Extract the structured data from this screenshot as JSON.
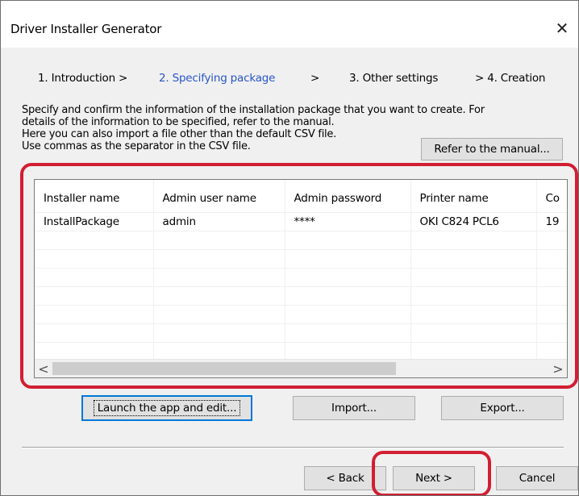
{
  "window": {
    "title": "Driver Installer Generator",
    "close_glyph": "✕"
  },
  "steps": [
    {
      "label": "1. Introduction >"
    },
    {
      "label": "2. Specifying package"
    },
    {
      "label": ">"
    },
    {
      "label": "3. Other settings"
    },
    {
      "label": "> 4. Creation"
    }
  ],
  "description": {
    "line1": "Specify and confirm the information of the installation package that you want to create. For",
    "line2": "details of the information to be specified, refer to the manual.",
    "line3": "Here you can also import a file other than the default CSV file.",
    "line4": "Use commas as the separator in the CSV file."
  },
  "buttons": {
    "manual": "Refer to the manual...",
    "launch": "Launch the app and edit...",
    "import": "Import...",
    "export": "Export...",
    "back": "< Back",
    "next": "Next >",
    "cancel": "Cancel"
  },
  "table": {
    "columns": [
      "Installer name",
      "Admin user name",
      "Admin password",
      "Printer name",
      "Co"
    ],
    "rows": [
      [
        "InstallPackage",
        "admin",
        "****",
        "OKI C824 PCL6",
        "19"
      ]
    ]
  },
  "scrollbar": {
    "left_arrow": "<",
    "right_arrow": ">"
  },
  "colors": {
    "highlight": "#d21e32",
    "active_step": "#2855c8",
    "default_button_border": "#0078d7"
  }
}
